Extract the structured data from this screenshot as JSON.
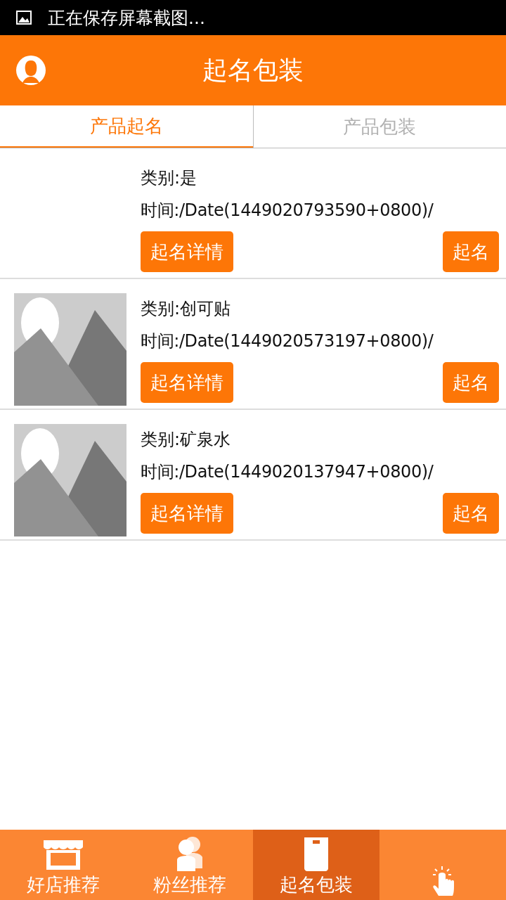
{
  "status_bar": {
    "notification": "正在保存屏幕截图..."
  },
  "header": {
    "title": "起名包装"
  },
  "tabs": [
    {
      "label": "产品起名",
      "selected": true
    },
    {
      "label": "产品包装",
      "selected": false
    }
  ],
  "items": [
    {
      "has_picture": false,
      "category": "类别:是",
      "time": "时间:/Date(1449020793590+0800)/",
      "details_button": "起名详情",
      "name_button": "起名"
    },
    {
      "has_picture": true,
      "category": "类别:创可贴",
      "time": "时间:/Date(1449020573197+0800)/",
      "details_button": "起名详情",
      "name_button": "起名"
    },
    {
      "has_picture": true,
      "category": "类别:矿泉水",
      "time": "时间:/Date(1449020137947+0800)/",
      "details_button": "起名详情",
      "name_button": "起名"
    }
  ],
  "bottom_nav": [
    {
      "kind": "shop",
      "label": "好店推荐",
      "selected": false
    },
    {
      "kind": "fans",
      "label": "粉丝推荐",
      "selected": false
    },
    {
      "kind": "bag",
      "label": "起名包装",
      "selected": true
    },
    {
      "kind": "hand",
      "selected": false
    }
  ]
}
